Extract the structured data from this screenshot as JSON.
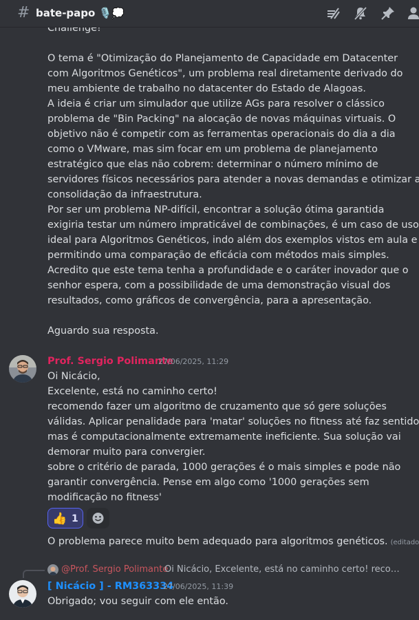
{
  "channel": {
    "name": "bate-papo 🎙️💭"
  },
  "toolbar_icons": [
    "threads-icon",
    "mute-icon",
    "pin-icon",
    "members-icon"
  ],
  "messages": [
    {
      "lines": [
        "Challenge!",
        "",
        "    O tema é \"Otimização do Planejamento de Capacidade em Datacenter",
        "com Algoritmos Genéticos\", um problema real diretamente derivado do",
        "meu ambiente de trabalho no datacenter do Estado de Alagoas.",
        "    A ideia é criar um simulador que utilize AGs para resolver o clássico",
        "problema de \"Bin Packing\" na alocação de novas máquinas virtuais. O",
        "objetivo não é competir com as ferramentas operacionais do dia a dia",
        "como o VMware, mas sim focar em um problema de planejamento",
        "estratégico que elas não cobrem: determinar o número mínimo de",
        "servidores físicos necessários para atender a novas demandas e otimizar a",
        "consolidação da infraestrutura.",
        "    Por ser um problema NP-difícil, encontrar a solução ótima garantida",
        "exigiria testar um número impraticável de combinações, é um caso de uso",
        "ideal para Algoritmos Genéticos, indo além dos exemplos vistos em aula e",
        "permitindo uma comparação de eficácia com métodos mais simples.",
        "Acredito que este tema tenha a profundidade e o caráter inovador que o",
        "senhor espera, com a possibilidade de uma demonstração visual dos",
        "resultados, como gráficos de convergência, para a apresentação.",
        "",
        "    Aguardo sua resposta."
      ]
    },
    {
      "author": "Prof. Sergio Polimante",
      "timestamp": "27/06/2025, 11:29",
      "lines": [
        "Oi Nicácio,",
        "Excelente, está no caminho certo!",
        "recomendo fazer um algoritmo de cruzamento que só gere soluções",
        "válidas. Aplicar penalidade para 'matar' soluções no fitness até faz sentido,",
        "mas é computacionalmente extremamente ineficiente. Sua solução vai",
        "demorar muito para convergier.",
        "sobre o critério de parada, 1000 gerações é o mais simples e pode não",
        "garantir convergência. Pense em algo como '1000 gerações sem",
        "modificação no fitness'"
      ],
      "reaction": {
        "emoji": "👍",
        "count": "1"
      },
      "followup": "O problema parece muito bem adequado para algoritmos genéticos.",
      "edited": "(editado)"
    },
    {
      "reply_to": {
        "author": "@Prof. Sergio Polimante",
        "text": "Oi Nicácio,  Excelente, está no caminho certo! recomendo fazer um algoritmo de cruzamento que só gere soluções válidas."
      },
      "author": "[ Nicácio ] - RM363334",
      "timestamp": "27/06/2025, 11:39",
      "lines": [
        "Obrigado; vou seguir com ele então."
      ]
    }
  ],
  "colors": {
    "background": "#313338",
    "text": "#dbdee1",
    "author_teacher": "#e0245e",
    "author_student": "#1e90ff",
    "reaction_border": "#5865f2"
  }
}
